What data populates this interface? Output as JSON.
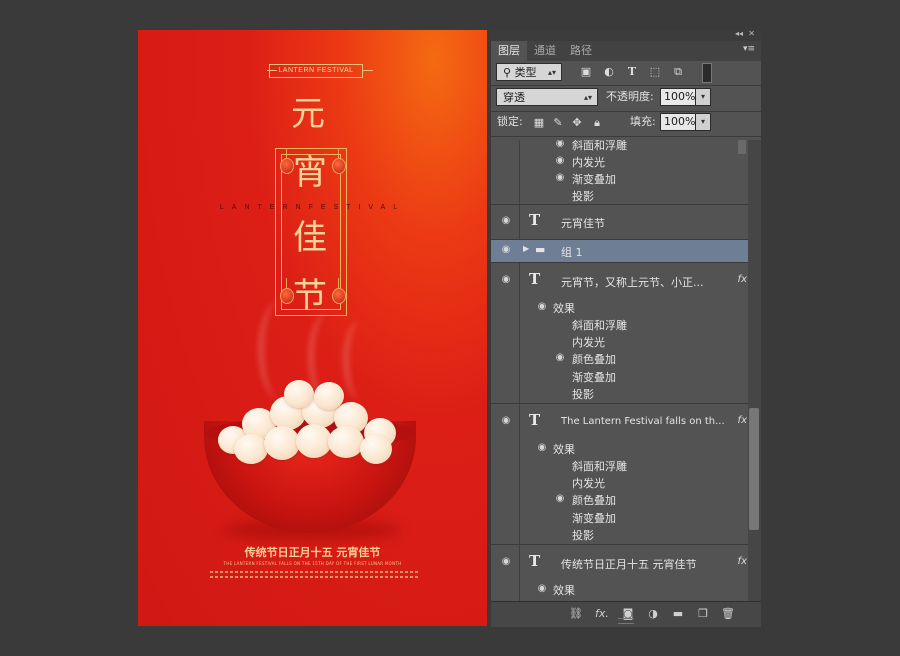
{
  "poster": {
    "top_banner": "LANTERN FESTIVAL",
    "title_chars": [
      "元",
      "宵",
      "佳",
      "节"
    ],
    "spaced_text": "LANTERNFESTIVAL",
    "bottom_title": "传统节日正月十五 元宵佳节",
    "bottom_sub": "THE LANTERN FESTIVAL FALLS ON THE 15TH DAY OF THE FIRST LUNAR MONTH",
    "colors": {
      "bg": "#d81c16",
      "gold": "#fbd39a"
    }
  },
  "panel": {
    "tabs": [
      "图层",
      "通道",
      "路径"
    ],
    "active_tab": 0,
    "collapse_icon": "double-chevron-left-icon",
    "close_icon": "close-icon",
    "menu_icon": "panel-menu-icon",
    "filter_kind": "类型",
    "blend_mode": "穿透",
    "opacity_label": "不透明度:",
    "opacity_value": "100%",
    "lock_label": "锁定:",
    "fill_label": "填充:",
    "fill_value": "100%",
    "filter_icons": [
      "image-filter-icon",
      "adjustment-filter-icon",
      "type-filter-icon",
      "shape-filter-icon",
      "smart-object-filter-icon",
      "filter-toggle-icon"
    ],
    "lock_icons": [
      "lock-transparent-icon",
      "lock-image-icon",
      "lock-position-icon",
      "lock-all-icon"
    ],
    "layers": [
      {
        "name": "斜面和浮雕",
        "eye": true
      },
      {
        "name": "内发光",
        "eye": true
      },
      {
        "name": "渐变叠加",
        "eye": true
      },
      {
        "name": "投影",
        "eye": false
      },
      {
        "name": "元宵佳节",
        "type": "text"
      },
      {
        "name": "组 1",
        "type": "group",
        "selected": true
      },
      {
        "name": "元宵节，又称上元节、小正...",
        "type": "text",
        "fx": "fx"
      },
      {
        "name": "效果"
      },
      {
        "name": "斜面和浮雕",
        "eye": false
      },
      {
        "name": "内发光",
        "eye": false
      },
      {
        "name": "颜色叠加",
        "eye": true
      },
      {
        "name": "渐变叠加",
        "eye": false
      },
      {
        "name": "投影",
        "eye": false
      },
      {
        "name": "The Lantern Festival falls on th...",
        "type": "text",
        "fx": "fx"
      },
      {
        "name": "效果"
      },
      {
        "name": "斜面和浮雕",
        "eye": false
      },
      {
        "name": "内发光",
        "eye": false
      },
      {
        "name": "颜色叠加",
        "eye": true
      },
      {
        "name": "渐变叠加",
        "eye": false
      },
      {
        "name": "投影",
        "eye": false
      },
      {
        "name": "传统节日正月十五 元宵佳节",
        "type": "text",
        "fx": "fx"
      },
      {
        "name": "效果"
      }
    ],
    "footer_icons": [
      "link-layers-icon",
      "fx-icon",
      "layer-mask-icon",
      "adjustment-layer-icon",
      "new-group-icon",
      "new-layer-icon",
      "trash-icon"
    ],
    "footer_fx": "fx."
  }
}
